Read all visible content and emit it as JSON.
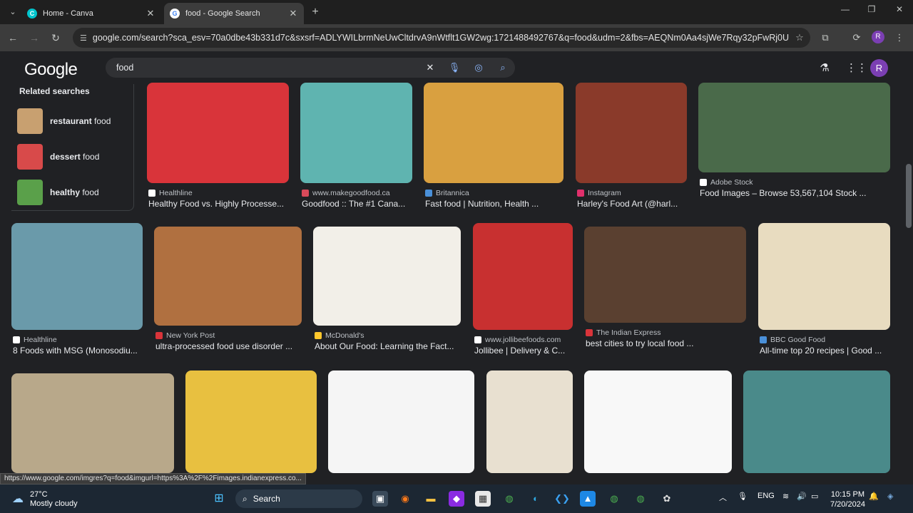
{
  "browser": {
    "tabs": [
      {
        "title": "Home - Canva",
        "active": false,
        "favicon_color": "#00c4cc",
        "favicon_letter": "C"
      },
      {
        "title": "food - Google Search",
        "active": true,
        "favicon_color": "#ffffff",
        "favicon_letter": "G"
      }
    ],
    "url": "google.com/search?sca_esv=70a0dbe43b331d7c&sxsrf=ADLYWILbrmNeUwCltdrvA9nWtflt1GW2wg:1721488492767&q=food&udm=2&fbs=AEQNm0Aa4sjWe7Rqy32pFwRj0UkWd8nbOJf...",
    "profile_letter": "R"
  },
  "google": {
    "logo": "Google",
    "query": "food",
    "avatar_letter": "R"
  },
  "related": {
    "heading": "Related searches",
    "items": [
      {
        "bold": "restaurant",
        "rest": " food",
        "color": "#c8a070"
      },
      {
        "bold": "dessert",
        "rest": " food",
        "color": "#d84a4a"
      },
      {
        "bold": "healthy",
        "rest": " food",
        "color": "#5aa04a"
      }
    ]
  },
  "images": [
    {
      "source": "Healthline",
      "caption": "Healthy Food vs. Highly Processe...",
      "color": "#d9343a",
      "src_color": "#ffffff"
    },
    {
      "source": "www.makegoodfood.ca",
      "caption": "Goodfood :: The #1 Cana...",
      "color": "#5fb4b0",
      "src_color": "#d94a5a"
    },
    {
      "source": "Britannica",
      "caption": "Fast food | Nutrition, Health ...",
      "color": "#d9a040",
      "src_color": "#4a90d9"
    },
    {
      "source": "Instagram",
      "caption": "Harley's Food Art (@harl...",
      "color": "#8a3a2a",
      "src_color": "#e1306c"
    },
    {
      "source": "Adobe Stock",
      "caption": "Food Images – Browse 53,567,104 Stock ...",
      "color": "#4a6a4a",
      "src_color": "#ffffff"
    },
    {
      "source": "Healthline",
      "caption": "8 Foods with MSG (Monosodiu...",
      "color": "#6a9aaa",
      "src_color": "#ffffff"
    },
    {
      "source": "New York Post",
      "caption": "ultra-processed food use disorder ...",
      "color": "#b07040",
      "src_color": "#d9343a"
    },
    {
      "source": "McDonald's",
      "caption": "About Our Food: Learning the Fact...",
      "color": "#f2efe8",
      "src_color": "#ffc72c"
    },
    {
      "source": "www.jollibeefoods.com",
      "caption": "Jollibee | Delivery & C...",
      "color": "#c83030",
      "src_color": "#ffffff"
    },
    {
      "source": "The Indian Express",
      "caption": "best cities to try local food ...",
      "color": "#5a4030",
      "src_color": "#d9343a"
    },
    {
      "source": "BBC Good Food",
      "caption": "All-time top 20 recipes | Good ...",
      "color": "#e8dcc0",
      "src_color": "#4a90d9"
    },
    {
      "source": "",
      "caption": "",
      "color": "#b8a88a",
      "src_color": "#ffffff"
    },
    {
      "source": "",
      "caption": "",
      "color": "#e8c040",
      "src_color": "#ffffff"
    },
    {
      "source": "",
      "caption": "",
      "color": "#f5f5f5",
      "src_color": "#ffffff"
    },
    {
      "source": "",
      "caption": "",
      "color": "#e8e0d0",
      "src_color": "#ffffff"
    },
    {
      "source": "",
      "caption": "",
      "color": "#f8f8f8",
      "src_color": "#ffffff"
    },
    {
      "source": "",
      "caption": "",
      "color": "#4a8a8a",
      "src_color": "#ffffff"
    }
  ],
  "status_url": "https://www.google.com/imgres?q=food&imgurl=https%3A%2F%2Fimages.indianexpress.co...",
  "taskbar": {
    "temp": "27°C",
    "weather": "Mostly cloudy",
    "search_label": "Search",
    "lang": "ENG",
    "time": "10:15 PM",
    "date": "7/20/2024"
  }
}
